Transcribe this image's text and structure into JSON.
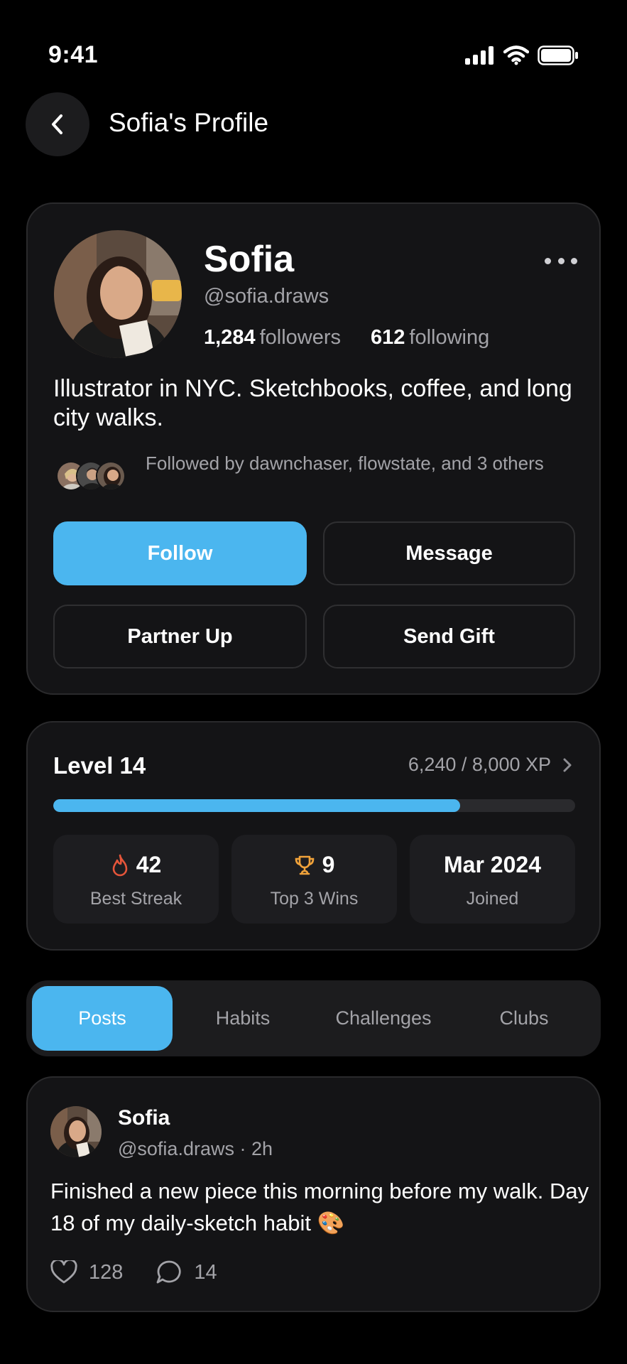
{
  "status": {
    "time": "9:41",
    "icons": [
      "signal-icon",
      "wifi-icon",
      "battery-icon"
    ]
  },
  "header": {
    "title": "Sofia's Profile",
    "back_icon": "chevron-left-icon"
  },
  "profile": {
    "name": "Sofia",
    "handle": "@sofia.draws",
    "followers_count": "1,284",
    "followers_label": "followers",
    "following_count": "612",
    "following_label": "following",
    "bio": "Illustrator in NYC. Sketchbooks, coffee, and long city walks.",
    "followed_by": "Followed by dawnchaser, flowstate, and 3 others",
    "buttons": {
      "follow": "Follow",
      "message": "Message",
      "partner": "Partner Up",
      "gift": "Send Gift"
    }
  },
  "level": {
    "title": "Level 14",
    "xp": "6,240 / 8,000 XP",
    "progress": 0.78,
    "stats": [
      {
        "value": "42",
        "label": "Best Streak",
        "icon": "flame-icon"
      },
      {
        "value": "9",
        "label": "Top 3 Wins",
        "icon": "trophy-icon"
      },
      {
        "value": "Mar 2024",
        "label": "Joined"
      }
    ]
  },
  "tabs": [
    {
      "label": "Posts",
      "active": true
    },
    {
      "label": "Habits"
    },
    {
      "label": "Challenges"
    },
    {
      "label": "Clubs"
    }
  ],
  "post": {
    "author": "Sofia",
    "meta": "@sofia.draws · 2h",
    "text": "Finished a new piece this morning before my walk. Day 18 of my daily-sketch habit 🎨",
    "likes": "128",
    "comments": "14"
  },
  "colors": {
    "accent": "#4bb6ef",
    "background": "#000000",
    "card": "#141416",
    "flame": "#e5553a",
    "trophy": "#f0a23a"
  }
}
